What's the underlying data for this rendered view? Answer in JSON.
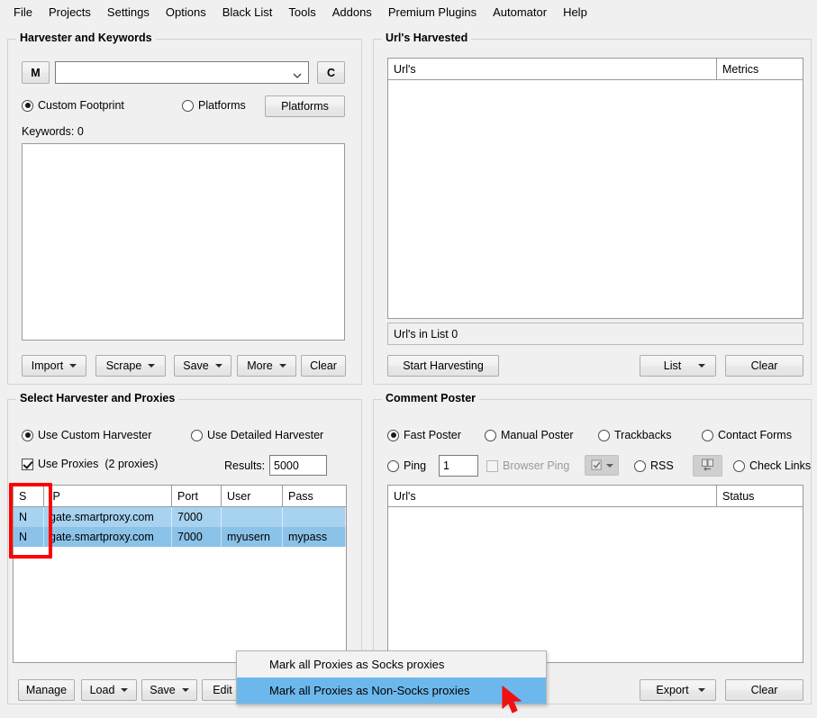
{
  "menubar": {
    "items": [
      {
        "label": "File"
      },
      {
        "label": "Projects"
      },
      {
        "label": "Settings"
      },
      {
        "label": "Options"
      },
      {
        "label": "Black List"
      },
      {
        "label": "Tools"
      },
      {
        "label": "Addons"
      },
      {
        "label": "Premium Plugins"
      },
      {
        "label": "Automator"
      },
      {
        "label": "Help"
      }
    ]
  },
  "harvester_keywords": {
    "title": "Harvester and Keywords",
    "m_button": "M",
    "c_button": "C",
    "combo_value": "",
    "radio_custom_footprint": "Custom Footprint",
    "radio_platforms": "Platforms",
    "platforms_button": "Platforms",
    "keywords_label": "Keywords:  0",
    "keywords_text": "",
    "buttons": [
      {
        "label": "Import",
        "caret": true
      },
      {
        "label": "Scrape",
        "caret": true
      },
      {
        "label": "Save",
        "caret": true
      },
      {
        "label": "More",
        "caret": true
      },
      {
        "label": "Clear",
        "caret": false
      }
    ]
  },
  "urls_harvested": {
    "title": "Url's Harvested",
    "columns": [
      "Url's",
      "Metrics"
    ],
    "rows": [],
    "status": "Url's in List  0",
    "start_button": "Start Harvesting",
    "list_button": "List",
    "clear_button": "Clear"
  },
  "select_harvester_proxies": {
    "title": "Select Harvester and Proxies",
    "radio_custom": "Use Custom Harvester",
    "radio_detailed": "Use Detailed Harvester",
    "check_use_proxies": "Use Proxies",
    "proxies_count": "(2 proxies)",
    "results_label": "Results:",
    "results_value": "5000",
    "columns": [
      "S",
      "IP",
      "Port",
      "User",
      "Pass"
    ],
    "rows": [
      {
        "s": "N",
        "ip": "gate.smartproxy.com",
        "port": "7000",
        "user": "",
        "pass": ""
      },
      {
        "s": "N",
        "ip": "gate.smartproxy.com",
        "port": "7000",
        "user": "myusern",
        "pass": "mypass"
      }
    ],
    "buttons": [
      {
        "label": "Manage",
        "caret": false
      },
      {
        "label": "Load",
        "caret": true
      },
      {
        "label": "Save",
        "caret": true
      },
      {
        "label": "Edit",
        "caret": false
      }
    ]
  },
  "comment_poster": {
    "title": "Comment Poster",
    "radio_fast_poster": "Fast Poster",
    "radio_manual_poster": "Manual Poster",
    "radio_trackbacks": "Trackbacks",
    "radio_contact_forms": "Contact Forms",
    "radio_ping": "Ping",
    "ping_value": "1",
    "check_browser_ping": "Browser Ping",
    "radio_rss": "RSS",
    "radio_check_links": "Check Links",
    "columns": [
      "Url's",
      "Status"
    ],
    "rows": [],
    "export_button": "Export",
    "clear_button": "Clear"
  },
  "context_menu": {
    "items": [
      {
        "label": "Mark all Proxies as Socks proxies",
        "highlighted": false
      },
      {
        "label": "Mark all Proxies as Non-Socks proxies",
        "highlighted": true
      }
    ]
  },
  "annotation": {
    "highlight_color": "#ff0000",
    "cursor_color": "#ee1111"
  }
}
